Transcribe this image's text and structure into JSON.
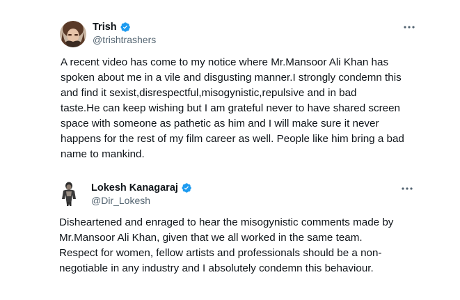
{
  "tweets": [
    {
      "display_name": "Trish",
      "handle": "@trishtrashers",
      "verified": true,
      "more_icon": "more-horizontal-icon",
      "text": "A recent video has come to my notice where Mr.Mansoor Ali Khan has\nspoken about me in a vile and disgusting manner.I strongly condemn this\nand find it sexist,disrespectful,misogynistic,repulsive and in bad\ntaste.He can keep wishing but I am grateful never to have shared screen\nspace with someone as pathetic as him and I will make sure it never\nhappens for the rest of my film career as well. People like him bring a bad\nname to mankind."
    },
    {
      "display_name": "Lokesh Kanagaraj",
      "handle": "@Dir_Lokesh",
      "verified": true,
      "more_icon": "more-horizontal-icon",
      "text": "Disheartened and enraged to hear the misogynistic comments made by\nMr.Mansoor Ali Khan, given that we all worked in the same team.\nRespect for women, fellow artists and professionals should be a non-\nnegotiable in any industry and I absolutely condemn this behaviour."
    }
  ],
  "colors": {
    "verified_blue": "#1d9bf0",
    "handle_gray": "#536471",
    "text": "#0f1419"
  }
}
